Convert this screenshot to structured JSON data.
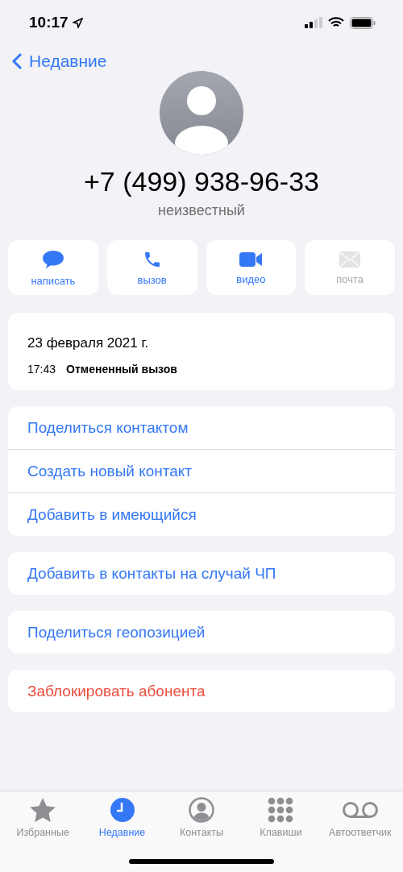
{
  "status_bar": {
    "time": "10:17"
  },
  "nav": {
    "back": "Недавние"
  },
  "contact": {
    "phone": "+7 (499) 938-96-33",
    "label": "неизвестный"
  },
  "actions": [
    {
      "label": "написать",
      "disabled": false
    },
    {
      "label": "вызов",
      "disabled": false
    },
    {
      "label": "видео",
      "disabled": false
    },
    {
      "label": "почта",
      "disabled": true
    }
  ],
  "call_log": {
    "date": "23 февраля 2021 г.",
    "entries": [
      {
        "time": "17:43",
        "status": "Отмененный вызов"
      }
    ]
  },
  "groups": [
    [
      {
        "label": "Поделиться контактом",
        "kind": "normal"
      },
      {
        "label": "Создать новый контакт",
        "kind": "normal"
      },
      {
        "label": "Добавить в имеющийся",
        "kind": "normal"
      }
    ],
    [
      {
        "label": "Добавить в контакты на случай ЧП",
        "kind": "normal"
      }
    ],
    [
      {
        "label": "Поделиться геопозицией",
        "kind": "normal"
      }
    ],
    [
      {
        "label": "Заблокировать абонента",
        "kind": "destructive"
      }
    ]
  ],
  "tabs": [
    {
      "label": "Избранные",
      "selected": false
    },
    {
      "label": "Недавние",
      "selected": true
    },
    {
      "label": "Контакты",
      "selected": false
    },
    {
      "label": "Клавиши",
      "selected": false
    },
    {
      "label": "Автоответчик",
      "selected": false
    }
  ]
}
